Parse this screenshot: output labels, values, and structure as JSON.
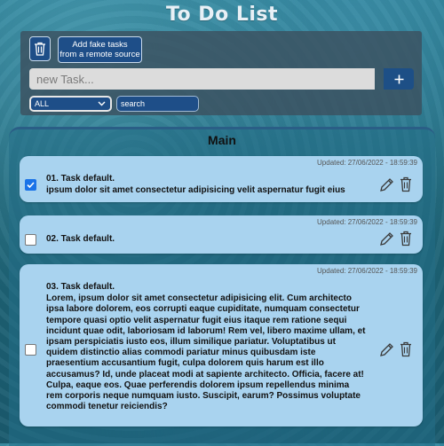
{
  "app": {
    "title": "To Do List"
  },
  "toolbar": {
    "fake_tasks_label_line1": "Add fake tasks",
    "fake_tasks_label_line2": "from a remote source",
    "new_task_placeholder": "new Task...",
    "add_label": "+",
    "filter_selected": "ALL",
    "search_placeholder": "search"
  },
  "main": {
    "title": "Main",
    "tasks": [
      {
        "updated": "Updated:   27/06/2022 - 18:59:39",
        "title": "01. Task default.",
        "description": "ipsum dolor sit amet consectetur adipisicing velit aspernatur fugit eius",
        "checked": true
      },
      {
        "updated": "Updated:   27/06/2022 - 18:59:39",
        "title": "02. Task default.",
        "description": "",
        "checked": false
      },
      {
        "updated": "Updated:   27/06/2022 - 18:59:39",
        "title": "03. Task default.",
        "description": "Lorem, ipsum dolor sit amet consectetur adipisicing elit. Cum architecto ipsa labore dolorem, eos corrupti eaque cupiditate, numquam consectetur tempore quasi optio velit aspernatur fugit eius itaque rem ratione sequi incidunt quae odit, laboriosam id laborum! Rem vel, libero maxime ullam, et ipsam perspiciatis iusto eos, illum similique pariatur. Voluptatibus ut quidem distinctio alias commodi pariatur minus quibusdam iste praesentium accusantium fugit, culpa dolorem quis harum est illo accusamus? Id, unde placeat modi at sapiente architecto. Officia, facere at! Culpa, eaque eos. Quae perferendis dolorem ipsum repellendus minima rem corporis neque numquam iusto. Suscipit, earum? Possimus voluptate commodi tenetur reiciendis?",
        "checked": false
      }
    ]
  },
  "colors": {
    "accent": "#1e4e88",
    "card": "#a9d3ef",
    "panel": "#3c505f"
  },
  "icons": {
    "delete_all": "trash-icon",
    "add": "plus-icon",
    "edit": "pencil-icon",
    "delete": "trash-icon",
    "filter": "chevron-down-icon"
  }
}
